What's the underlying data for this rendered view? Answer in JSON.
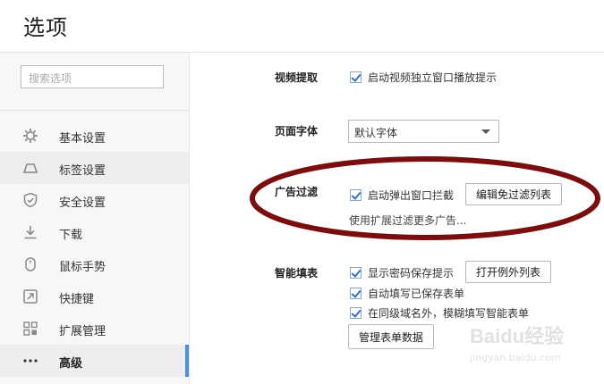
{
  "window": {
    "title": "选项"
  },
  "search": {
    "placeholder": "搜索选项"
  },
  "sidebar": {
    "items": [
      {
        "label": "基本设置",
        "icon": "gear-icon"
      },
      {
        "label": "标签设置",
        "icon": "tab-icon"
      },
      {
        "label": "安全设置",
        "icon": "shield-icon"
      },
      {
        "label": "下载",
        "icon": "download-icon"
      },
      {
        "label": "鼠标手势",
        "icon": "mouse-icon"
      },
      {
        "label": "快捷键",
        "icon": "shortcut-icon"
      },
      {
        "label": "扩展管理",
        "icon": "extensions-icon"
      },
      {
        "label": "高级",
        "icon": "more-icon"
      }
    ]
  },
  "video": {
    "label": "视频提取",
    "checkbox_label": "启动视频独立窗口播放提示",
    "checked": true
  },
  "font": {
    "label": "页面字体",
    "selected": "默认字体"
  },
  "adblock": {
    "label": "广告过滤",
    "checkbox_label": "启动弹出窗口拦截",
    "checked": true,
    "button_label": "编辑免过滤列表",
    "hint": "使用扩展过滤更多广告..."
  },
  "autofill": {
    "label": "智能填表",
    "options": [
      {
        "label": "显示密码保存提示",
        "checked": true
      },
      {
        "label": "自动填写已保存表单",
        "checked": true
      },
      {
        "label": "在同级域名外，模糊填写智能表单",
        "checked": true
      }
    ],
    "exception_button_label": "打开例外列表",
    "manage_button_label": "管理表单数据"
  },
  "annotation": {
    "color": "#7a0d0d"
  },
  "watermark": {
    "main": "Baidu经验",
    "sub": "jingyan.baidu.com"
  },
  "colors": {
    "accent": "#4a8fe2"
  }
}
